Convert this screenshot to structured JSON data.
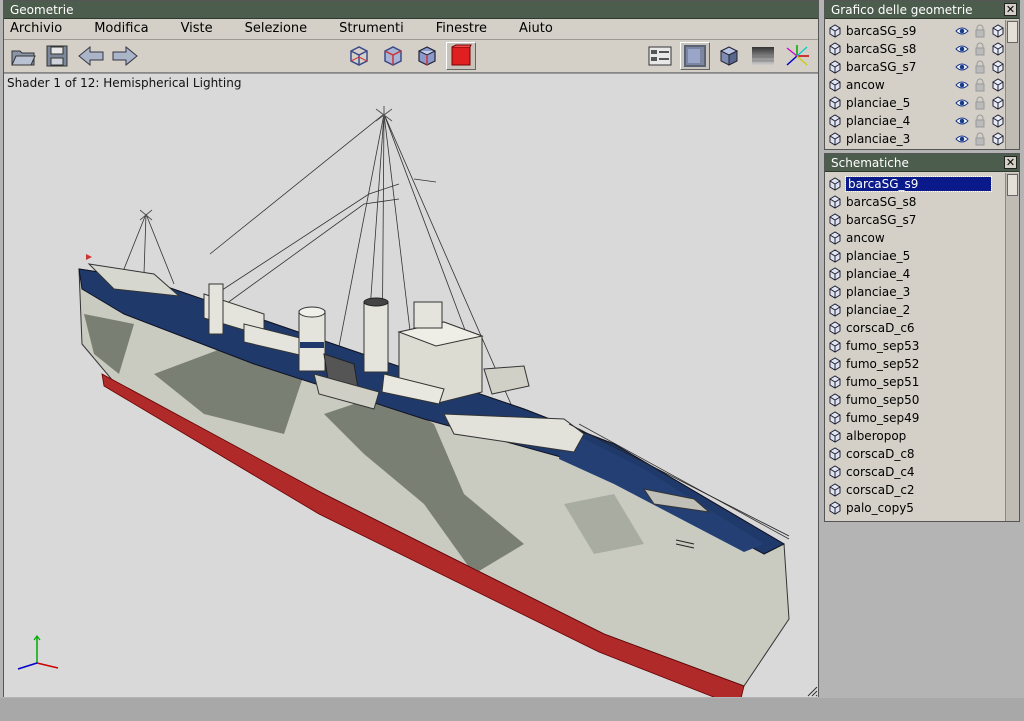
{
  "main_window": {
    "title": "Geometrie",
    "menu": [
      "Archivio",
      "Modifica",
      "Viste",
      "Selezione",
      "Strumenti",
      "Finestre",
      "Aiuto"
    ],
    "toolbar": {
      "left_buttons": [
        "open-folder-icon",
        "save-disk-icon",
        "arrow-left-icon",
        "arrow-right-icon"
      ],
      "view_buttons": [
        "wireframe-cube-icon",
        "wireframe-cube-red-icon",
        "wireframe-cube-shaded-icon",
        "solid-red-cube-icon"
      ],
      "right_buttons": [
        "properties-panel-icon",
        "shaded-cube-icon",
        "flat-cube-icon",
        "texture-gradient-icon",
        "axes-star-icon"
      ]
    },
    "viewport": {
      "shader_label": "Shader 1 of 12: Hemispherical Lighting"
    }
  },
  "graph_panel": {
    "title": "Grafico delle geometrie",
    "items": [
      "barcaSG_s9",
      "barcaSG_s8",
      "barcaSG_s7",
      "ancow",
      "planciae_5",
      "planciae_4",
      "planciae_3"
    ]
  },
  "schematics_panel": {
    "title": "Schematiche",
    "selected": "barcaSG_s9",
    "items": [
      "barcaSG_s9",
      "barcaSG_s8",
      "barcaSG_s7",
      "ancow",
      "planciae_5",
      "planciae_4",
      "planciae_3",
      "planciae_2",
      "corscaD_c6",
      "fumo_sep53",
      "fumo_sep52",
      "fumo_sep51",
      "fumo_sep50",
      "fumo_sep49",
      "alberopop",
      "corscaD_c8",
      "corscaD_c4",
      "corscaD_c2",
      "palo_copy5"
    ]
  },
  "colors": {
    "titlebar": "#4d5d4d",
    "selection": "#0a1a8a",
    "viewport_bg": "#d9d9d9",
    "hull_red": "#b02a2a",
    "deck_blue": "#1f3a6a"
  }
}
